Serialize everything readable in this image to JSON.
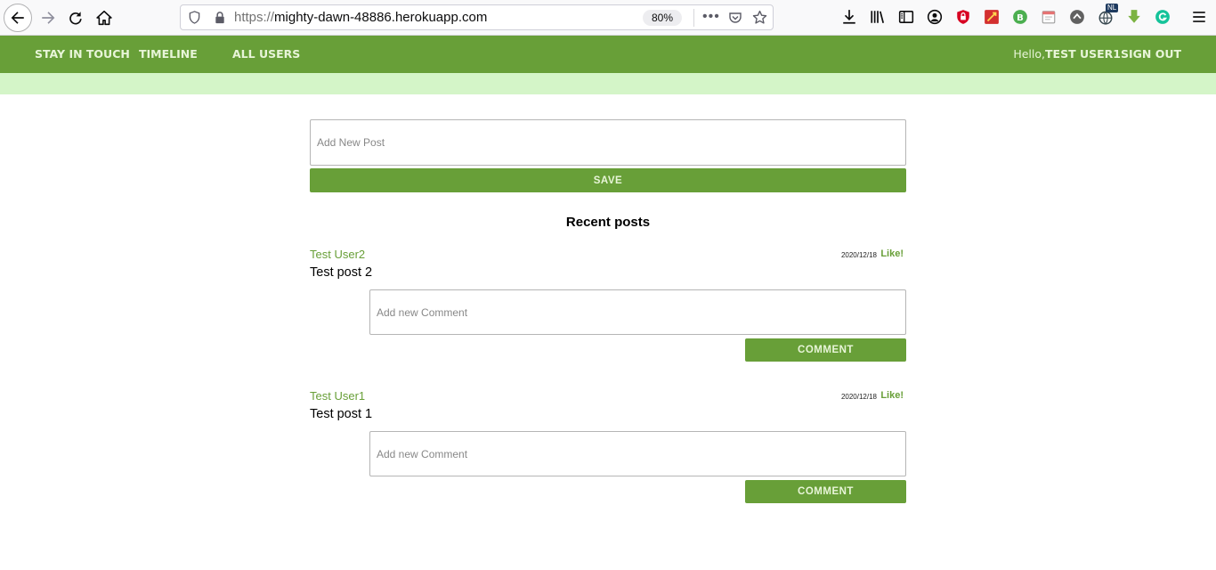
{
  "browser": {
    "url_protocol": "https://",
    "url_host": "mighty-dawn-48886.herokuapp.com",
    "zoom": "80%",
    "more_label": "•••",
    "ext_badge": "NL"
  },
  "nav": {
    "brand": "STAY IN TOUCH",
    "timeline": "TIMELINE",
    "all_users": "ALL USERS",
    "greeting": "Hello,",
    "username": "TEST USER1",
    "sign_out": "SIGN OUT"
  },
  "new_post": {
    "placeholder": "Add New Post",
    "save_label": "SAVE"
  },
  "recent_title": "Recent posts",
  "posts": [
    {
      "author": "Test User2",
      "date": "2020/12/18",
      "like_label": "Like!",
      "body": "Test post 2",
      "comment_placeholder": "Add new Comment",
      "comment_label": "COMMENT"
    },
    {
      "author": "Test User1",
      "date": "2020/12/18",
      "like_label": "Like!",
      "body": "Test post 1",
      "comment_placeholder": "Add new Comment",
      "comment_label": "COMMENT"
    }
  ],
  "colors": {
    "nav_green": "#689f38",
    "notice_green": "#d4f5c8",
    "link_green": "#689f38"
  }
}
